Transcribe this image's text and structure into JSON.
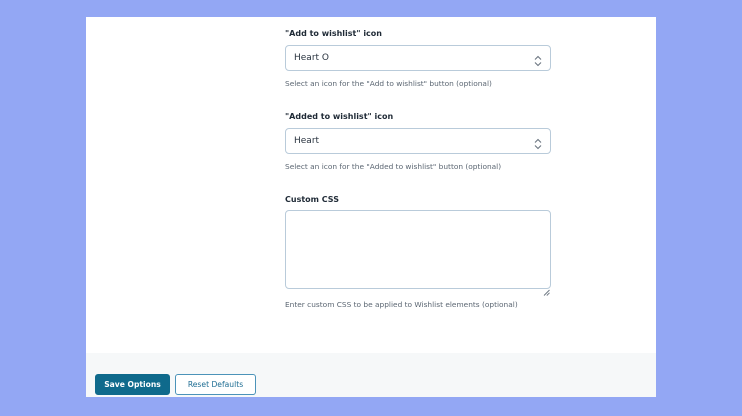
{
  "settings": {
    "add_icon": {
      "label": "\"Add to wishlist\" icon",
      "value": "Heart O",
      "help": "Select an icon for the \"Add to wishlist\" button (optional)"
    },
    "added_icon": {
      "label": "\"Added to wishlist\" icon",
      "value": "Heart",
      "help": "Select an icon for the \"Added to wishlist\" button (optional)"
    },
    "custom_css": {
      "label": "Custom CSS",
      "value": "",
      "help": "Enter custom CSS to be applied to Wishlist elements (optional)"
    }
  },
  "footer": {
    "save_label": "Save Options",
    "reset_label": "Reset Defaults"
  },
  "colors": {
    "page_background": "#93a7f4",
    "primary_button": "#0f6a8c",
    "secondary_button_border": "#4b93b9",
    "field_border": "#b9cbda"
  },
  "icons": {
    "select_arrows": "select-updown-icon",
    "textarea_resize": "resize-grip-icon"
  }
}
